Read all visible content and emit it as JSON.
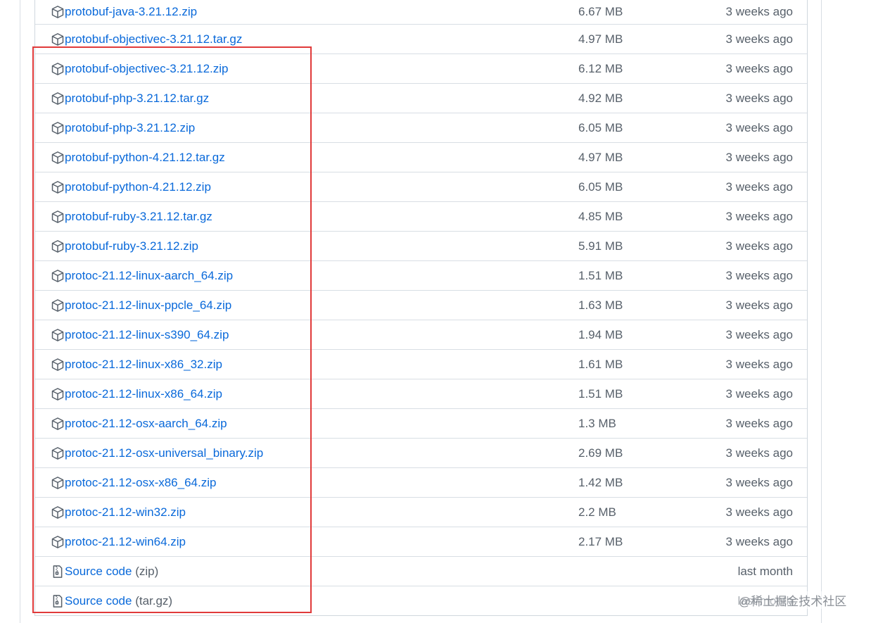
{
  "assets": [
    {
      "name": "protobuf-java-3.21.12.zip",
      "size": "6.67 MB",
      "time": "3 weeks ago",
      "icon": "package-icon"
    },
    {
      "name": "protobuf-objectivec-3.21.12.tar.gz",
      "size": "4.97 MB",
      "time": "3 weeks ago",
      "icon": "package-icon"
    },
    {
      "name": "protobuf-objectivec-3.21.12.zip",
      "size": "6.12 MB",
      "time": "3 weeks ago",
      "icon": "package-icon"
    },
    {
      "name": "protobuf-php-3.21.12.tar.gz",
      "size": "4.92 MB",
      "time": "3 weeks ago",
      "icon": "package-icon"
    },
    {
      "name": "protobuf-php-3.21.12.zip",
      "size": "6.05 MB",
      "time": "3 weeks ago",
      "icon": "package-icon"
    },
    {
      "name": "protobuf-python-4.21.12.tar.gz",
      "size": "4.97 MB",
      "time": "3 weeks ago",
      "icon": "package-icon"
    },
    {
      "name": "protobuf-python-4.21.12.zip",
      "size": "6.05 MB",
      "time": "3 weeks ago",
      "icon": "package-icon"
    },
    {
      "name": "protobuf-ruby-3.21.12.tar.gz",
      "size": "4.85 MB",
      "time": "3 weeks ago",
      "icon": "package-icon"
    },
    {
      "name": "protobuf-ruby-3.21.12.zip",
      "size": "5.91 MB",
      "time": "3 weeks ago",
      "icon": "package-icon"
    },
    {
      "name": "protoc-21.12-linux-aarch_64.zip",
      "size": "1.51 MB",
      "time": "3 weeks ago",
      "icon": "package-icon"
    },
    {
      "name": "protoc-21.12-linux-ppcle_64.zip",
      "size": "1.63 MB",
      "time": "3 weeks ago",
      "icon": "package-icon"
    },
    {
      "name": "protoc-21.12-linux-s390_64.zip",
      "size": "1.94 MB",
      "time": "3 weeks ago",
      "icon": "package-icon"
    },
    {
      "name": "protoc-21.12-linux-x86_32.zip",
      "size": "1.61 MB",
      "time": "3 weeks ago",
      "icon": "package-icon"
    },
    {
      "name": "protoc-21.12-linux-x86_64.zip",
      "size": "1.51 MB",
      "time": "3 weeks ago",
      "icon": "package-icon"
    },
    {
      "name": "protoc-21.12-osx-aarch_64.zip",
      "size": "1.3 MB",
      "time": "3 weeks ago",
      "icon": "package-icon"
    },
    {
      "name": "protoc-21.12-osx-universal_binary.zip",
      "size": "2.69 MB",
      "time": "3 weeks ago",
      "icon": "package-icon"
    },
    {
      "name": "protoc-21.12-osx-x86_64.zip",
      "size": "1.42 MB",
      "time": "3 weeks ago",
      "icon": "package-icon"
    },
    {
      "name": "protoc-21.12-win32.zip",
      "size": "2.2 MB",
      "time": "3 weeks ago",
      "icon": "package-icon"
    },
    {
      "name": "protoc-21.12-win64.zip",
      "size": "2.17 MB",
      "time": "3 weeks ago",
      "icon": "package-icon"
    },
    {
      "name": "Source code",
      "suffix": "(zip)",
      "size": "",
      "time": "last month",
      "icon": "file-zip-icon"
    },
    {
      "name": "Source code",
      "suffix": "(tar.gz)",
      "size": "",
      "time": "last month",
      "icon": "file-zip-icon"
    }
  ],
  "watermark": "@稀土掘金技术社区",
  "colors": {
    "link": "#0969da",
    "muted": "#57606a",
    "border": "#d8dee4",
    "highlight": "#e03a3a"
  }
}
